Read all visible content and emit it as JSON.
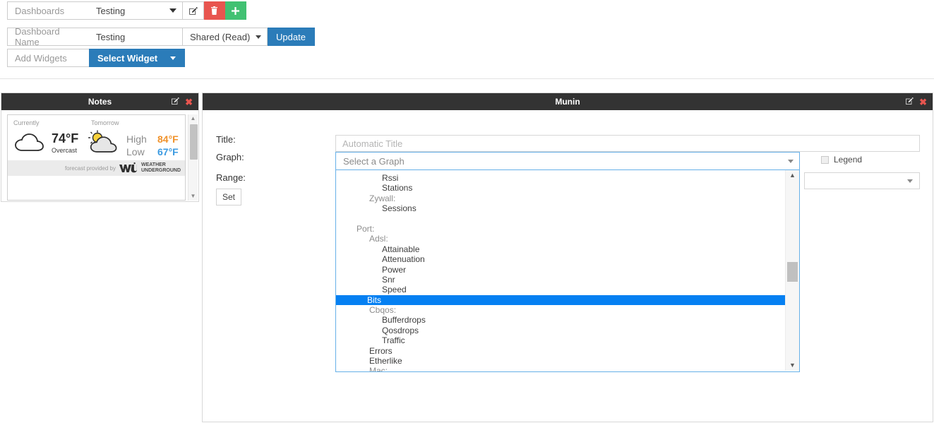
{
  "toolbar": {
    "dashboards_label": "Dashboards",
    "dashboards_value": "Testing",
    "edit_icon": "edit-pencil-square-icon",
    "delete_icon": "trash-icon",
    "add_icon": "plus-icon",
    "dashboard_name_label": "Dashboard Name",
    "dashboard_name_value": "Testing",
    "share_value": "Shared (Read)",
    "update_label": "Update",
    "add_widgets_label": "Add Widgets",
    "select_widget_label": "Select Widget"
  },
  "notes_panel": {
    "title": "Notes",
    "weather": {
      "currently_label": "Currently",
      "current_temp": "74°F",
      "current_condition": "Overcast",
      "tomorrow_label": "Tomorrow",
      "high_label": "High",
      "high_value": "84°F",
      "low_label": "Low",
      "low_value": "67°F",
      "credit": "forecast provided by",
      "brand_line1": "WEATHER",
      "brand_line2": "UNDERGROUND"
    }
  },
  "munin_panel": {
    "title": "Munin",
    "labels": {
      "title": "Title:",
      "graph": "Graph:",
      "range": "Range:"
    },
    "title_input_placeholder": "Automatic Title",
    "title_input_value": "",
    "graph_select_value": "Select a Graph",
    "legend_label": "Legend",
    "legend_checked": false,
    "range_select_value": "",
    "set_button_label": "Set",
    "dropdown": {
      "selected": "Bits",
      "items": [
        {
          "text": "Rssi",
          "level": 2,
          "group": false
        },
        {
          "text": "Stations",
          "level": 2,
          "group": false
        },
        {
          "text": "Zywall:",
          "level": 1,
          "group": true
        },
        {
          "text": "Sessions",
          "level": 2,
          "group": false
        },
        {
          "text": "",
          "level": 0,
          "group": false,
          "blank": true
        },
        {
          "text": "Port:",
          "level": 0,
          "group": true
        },
        {
          "text": "Adsl:",
          "level": 1,
          "group": true
        },
        {
          "text": "Attainable",
          "level": 2,
          "group": false
        },
        {
          "text": "Attenuation",
          "level": 2,
          "group": false
        },
        {
          "text": "Power",
          "level": 2,
          "group": false
        },
        {
          "text": "Snr",
          "level": 2,
          "group": false
        },
        {
          "text": "Speed",
          "level": 2,
          "group": false
        },
        {
          "text": "Bits",
          "level": 1,
          "group": false,
          "selected": true
        },
        {
          "text": "Cbqos:",
          "level": 1,
          "group": true
        },
        {
          "text": "Bufferdrops",
          "level": 2,
          "group": false
        },
        {
          "text": "Qosdrops",
          "level": 2,
          "group": false
        },
        {
          "text": "Traffic",
          "level": 2,
          "group": false
        },
        {
          "text": "Errors",
          "level": 1,
          "group": false
        },
        {
          "text": "Etherlike",
          "level": 1,
          "group": false
        },
        {
          "text": "Mac:",
          "level": 1,
          "group": true
        }
      ]
    }
  },
  "icons": {
    "scroll_up": "▲",
    "scroll_down": "▼",
    "panel_edit": "edit-square-icon",
    "panel_close": "close-x-icon"
  },
  "colors": {
    "accent_blue": "#2b7cb9",
    "danger_red": "#e8554f",
    "success_green": "#41c172",
    "select_blue": "#0580f2",
    "panel_header": "#333333",
    "high_orange": "#f0922b",
    "low_blue": "#3b9ae1"
  }
}
